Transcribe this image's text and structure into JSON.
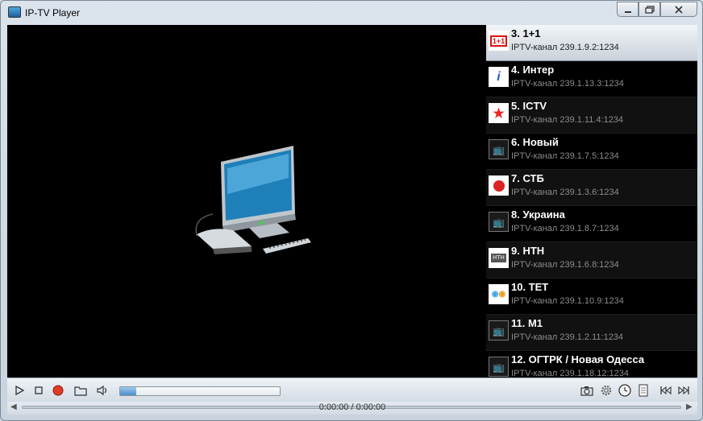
{
  "window": {
    "title": "IP-TV Player"
  },
  "channels": [
    {
      "name": "3. 1+1",
      "address": "IPTV-канал 239.1.9.2:1234",
      "logo": "1+1",
      "selected": true
    },
    {
      "name": "4. Интер",
      "address": "IPTV-канал 239.1.13.3:1234",
      "logo": "inter-logo"
    },
    {
      "name": "5. ICTV",
      "address": "IPTV-канал 239.1.11.4:1234",
      "logo": "ictv-logo"
    },
    {
      "name": "6. Новый",
      "address": "IPTV-канал 239.1.7.5:1234",
      "logo": "tv-icon"
    },
    {
      "name": "7. СТБ",
      "address": "IPTV-канал 239.1.3.6:1234",
      "logo": "stb-logo"
    },
    {
      "name": "8. Украина",
      "address": "IPTV-канал 239.1.8.7:1234",
      "logo": "tv-icon"
    },
    {
      "name": "9. НТН",
      "address": "IPTV-канал 239.1.6.8:1234",
      "logo": "ntn-logo"
    },
    {
      "name": "10. ТЕТ",
      "address": "IPTV-канал 239.1.10.9:1234",
      "logo": "tet-logo"
    },
    {
      "name": "11. М1",
      "address": "IPTV-канал 239.1.2.11:1234",
      "logo": "tv-icon"
    },
    {
      "name": "12. ОГТРК / Новая Одесса",
      "address": "IPTV-канал 239.1.18.12:1234",
      "logo": "tv-icon"
    }
  ],
  "playback": {
    "time": "0:00:00 / 0:00:00",
    "volume_fraction": 0.1
  },
  "colors": {
    "record": "#e03a2a",
    "selected_row": "#dde3ea"
  }
}
